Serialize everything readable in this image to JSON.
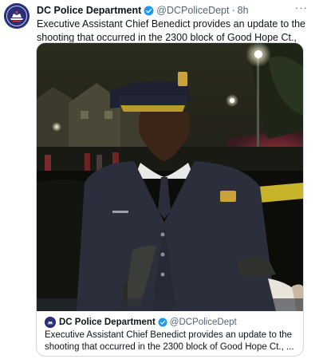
{
  "tweet": {
    "author_name": "DC Police Department",
    "handle": "@DCPoliceDept",
    "separator": "·",
    "time": "8h",
    "more_label": "···",
    "text": "Executive Assistant Chief Benedict provides an update to the shooting that occurred in the 2300 block of Good Hope Ct., Southeast."
  },
  "quoted_tweet": {
    "author_name": "DC Police Department",
    "handle": "@DCPoliceDept",
    "text": "Executive Assistant Chief Benedict provides an update to the shooting that occurred in the 2300 block of Good Hope Ct., ..."
  },
  "icons": {
    "avatar": "dc-police-badge-icon",
    "verified": "verified-badge-icon",
    "more": "more-options-icon"
  },
  "colors": {
    "verified_blue": "#1d9bf0",
    "avatar_bg": "#2a2f7a",
    "muted_text": "#536471",
    "card_border": "#cfd9de"
  }
}
